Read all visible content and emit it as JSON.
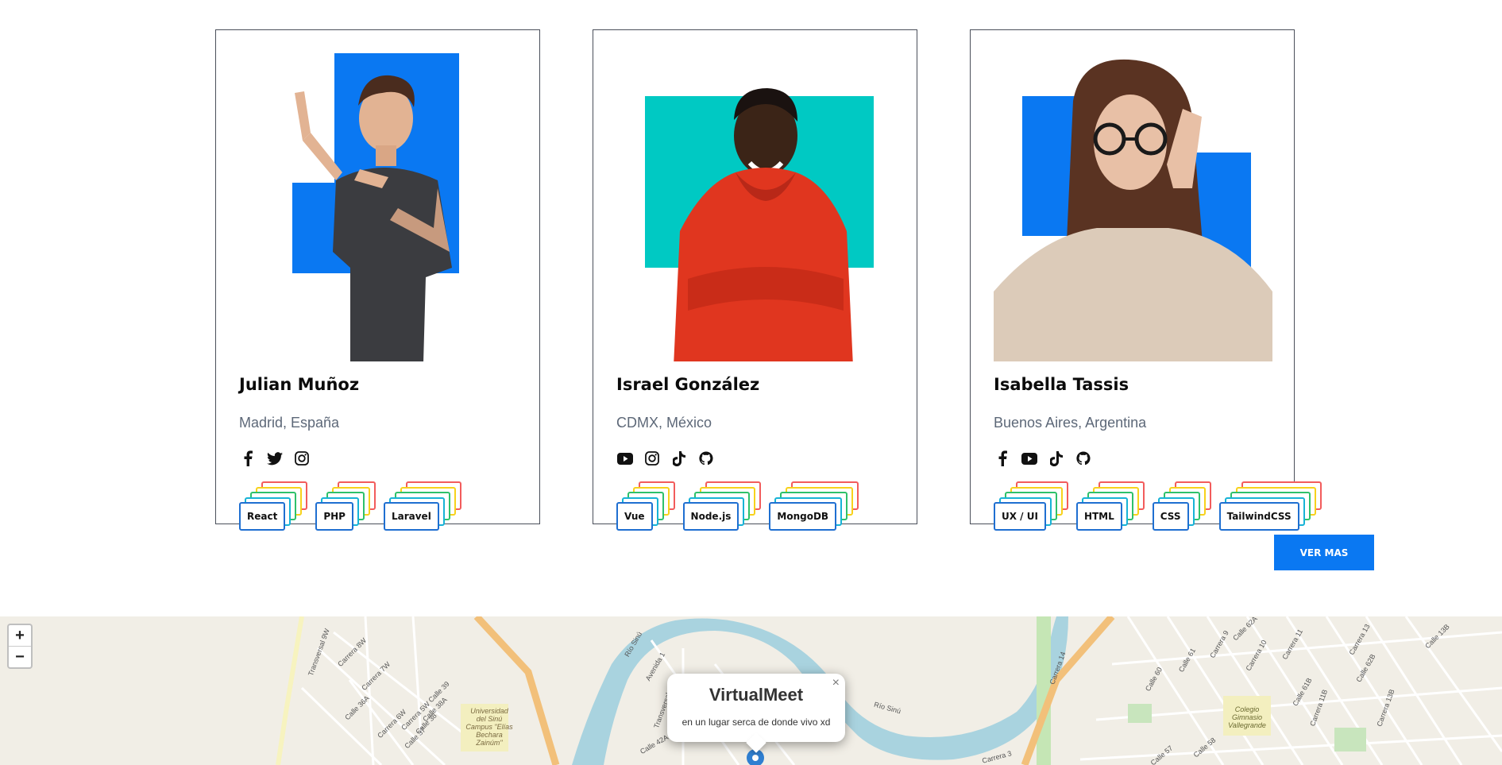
{
  "cards": [
    {
      "name": "Julian Muñoz",
      "location": "Madrid, España",
      "accent": "#0a78f2",
      "socials": [
        "facebook-icon",
        "twitter-icon",
        "instagram-icon"
      ],
      "tags": [
        "React",
        "PHP",
        "Laravel"
      ]
    },
    {
      "name": "Israel González",
      "location": "CDMX, México",
      "accent": "#00c9c3",
      "socials": [
        "youtube-icon",
        "instagram-icon",
        "tiktok-icon",
        "github-icon"
      ],
      "tags": [
        "Vue",
        "Node.js",
        "MongoDB"
      ]
    },
    {
      "name": "Isabella Tassis",
      "location": "Buenos Aires, Argentina",
      "accent": "#0a78f2",
      "socials": [
        "facebook-icon",
        "youtube-icon",
        "tiktok-icon",
        "github-icon"
      ],
      "tags": [
        "UX / UI",
        "HTML",
        "CSS",
        "TailwindCSS"
      ]
    }
  ],
  "ver_mas_label": "VER MAS",
  "map": {
    "zoom_in": "+",
    "zoom_out": "−",
    "popup_title": "VirtualMeet",
    "popup_text": "en un lugar serca de donde vivo xd",
    "popup_close": "×",
    "labels": {
      "rio_sinu_1": "Río Sinú",
      "rio_sinu_2": "Río Sinú",
      "transversal_9w": "Transversal 9W",
      "carrera_8w": "Carrera 8W",
      "carrera_7w": "Carrera 7W",
      "carrera_6w": "Carrera 6W",
      "carrera_5w": "Carrera 5W",
      "calle_39": "Calle 39",
      "calle_38a": "Calle 38A",
      "calle_38": "Calle 38",
      "calle_37": "Calle 37",
      "calle_36a": "Calle 36A",
      "avenida_1": "Avenida 1",
      "transversal_1": "Transversal 1",
      "calle_42a": "Calle 42A",
      "carrera_14": "Carrera 14",
      "carrera_3": "Carrera 3",
      "campus": "Universidad del Sinú Campus \"Elías Bechara Zainúm\"",
      "colegio": "Colegio Gimnasio Vallegrande",
      "calle_60": "Calle 60",
      "calle_61": "Calle 61",
      "calle_57": "Calle 57",
      "calle_58": "Calle 58",
      "calle_62a": "Calle 62A",
      "calle_61b": "Calle 61B",
      "carrera_9": "Carrera 9",
      "carrera_10": "Carrera 10",
      "carrera_11": "Carrera 11",
      "carrera_13": "Carrera 13",
      "carrera_11b": "Carrera 11B",
      "carrera_13b": "Carrera 13B",
      "calle_13b": "Calle 13B",
      "calle_62b": "Calle 62B"
    }
  }
}
